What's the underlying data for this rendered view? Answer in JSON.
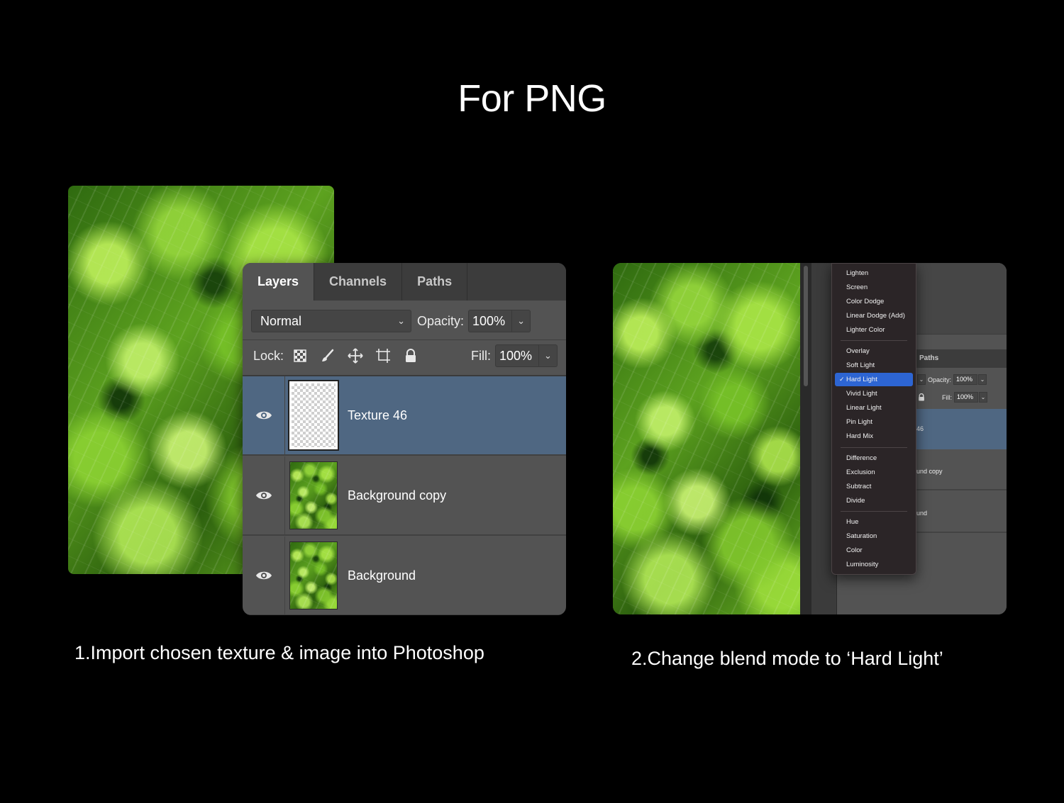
{
  "title": "For PNG",
  "step1": {
    "number": "1.",
    "text": "Import chosen texture & image into Photoshop"
  },
  "step2": {
    "number": "2.",
    "text": "Change blend mode to ‘Hard Light’"
  },
  "layers_panel": {
    "tabs": [
      "Layers",
      "Channels",
      "Paths"
    ],
    "active_tab": "Layers",
    "blend_mode": "Normal",
    "opacity_label": "Opacity:",
    "opacity_value": "100%",
    "lock_label": "Lock:",
    "lock_icons": [
      "lock-transparent-pixels-icon",
      "lock-image-pixels-icon",
      "lock-position-icon",
      "lock-artboard-icon",
      "lock-all-icon"
    ],
    "fill_label": "Fill:",
    "fill_value": "100%",
    "layers": [
      {
        "name": "Texture 46",
        "selected": true,
        "thumbnail": "transparent"
      },
      {
        "name": "Background copy",
        "selected": false,
        "thumbnail": "broccoli"
      },
      {
        "name": "Background",
        "selected": false,
        "thumbnail": "broccoli"
      }
    ]
  },
  "blend_panel": {
    "tab_partial": "Paths",
    "opacity_label": "Opacity:",
    "opacity_value": "100%",
    "fill_label": "Fill:",
    "fill_value": "100%",
    "layer_partials": [
      "46",
      "und copy",
      "und"
    ],
    "menu_groups": [
      [
        "Lighten",
        "Screen",
        "Color Dodge",
        "Linear Dodge (Add)",
        "Lighter Color"
      ],
      [
        "Overlay",
        "Soft Light",
        "Hard Light",
        "Vivid Light",
        "Linear Light",
        "Pin Light",
        "Hard Mix"
      ],
      [
        "Difference",
        "Exclusion",
        "Subtract",
        "Divide"
      ],
      [
        "Hue",
        "Saturation",
        "Color",
        "Luminosity"
      ]
    ],
    "selected_mode": "Hard Light",
    "checkmark": "✓"
  },
  "colors": {
    "background": "#000000",
    "panel": "#535353",
    "selected_layer": "#4f6782",
    "menu_highlight": "#2d65d3"
  }
}
